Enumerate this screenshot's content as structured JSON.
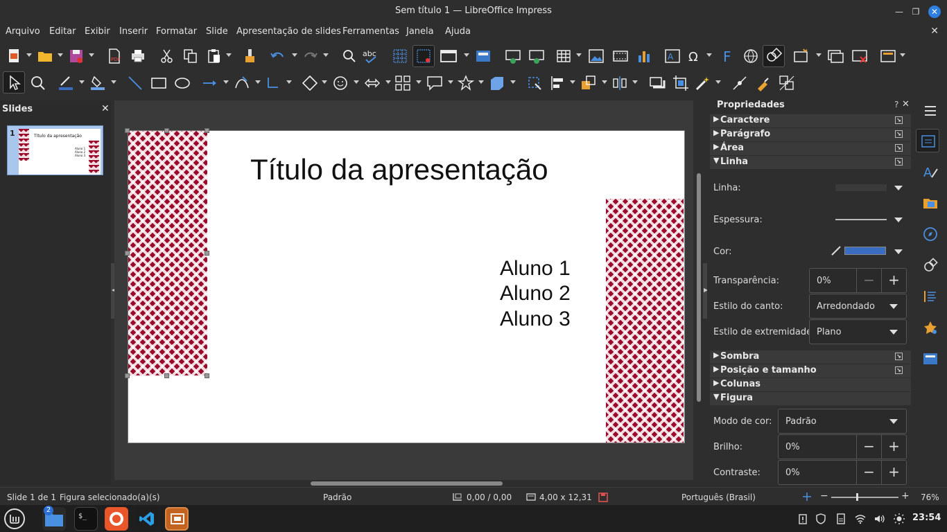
{
  "window": {
    "title": "Sem título 1 — LibreOffice Impress"
  },
  "menu": {
    "items": [
      "Arquivo",
      "Editar",
      "Exibir",
      "Inserir",
      "Formatar",
      "Slide",
      "Apresentação de slides",
      "Ferramentas",
      "Janela",
      "Ajuda"
    ]
  },
  "slides_panel": {
    "title": "Slides",
    "thumb_number": "1",
    "thumb_title": "Título da apresentação",
    "thumb_lines": [
      "Aluno 1",
      "Aluno 2",
      "Aluno 3"
    ]
  },
  "slide": {
    "title": "Título da apresentação",
    "subtitle_lines": [
      "Aluno 1",
      "Aluno 2",
      "Aluno 3"
    ]
  },
  "sidebar": {
    "title": "Propriedades",
    "help": "?",
    "sections": {
      "caractere": "Caractere",
      "paragrafo": "Parágrafo",
      "area": "Área",
      "linha": "Linha",
      "sombra": "Sombra",
      "posicao": "Posição e tamanho",
      "colunas": "Colunas",
      "figura": "Figura"
    },
    "linha": {
      "linha_label": "Linha:",
      "espessura_label": "Espessura:",
      "cor_label": "Cor:",
      "cor_value": "#3a6cbf",
      "transparencia_label": "Transparência:",
      "transparencia_value": "0%",
      "canto_label": "Estilo do canto:",
      "canto_value": "Arredondado",
      "extremidade_label": "Estilo de extremidade:",
      "extremidade_value": "Plano"
    },
    "figura": {
      "modo_label": "Modo de cor:",
      "modo_value": "Padrão",
      "brilho_label": "Brilho:",
      "brilho_value": "0%",
      "contraste_label": "Contraste:",
      "contraste_value": "0%"
    }
  },
  "status": {
    "slide_pos": "Slide 1 de 1",
    "selection": "Figura selecionado(a)(s)",
    "layout": "Padrão",
    "position": "0,00 / 0,00",
    "size": "4,00 x 12,31",
    "language": "Português (Brasil)",
    "zoom": "76%"
  },
  "taskbar": {
    "files_badge": "2",
    "terminal_glyph": "$_",
    "time": "23:54"
  }
}
